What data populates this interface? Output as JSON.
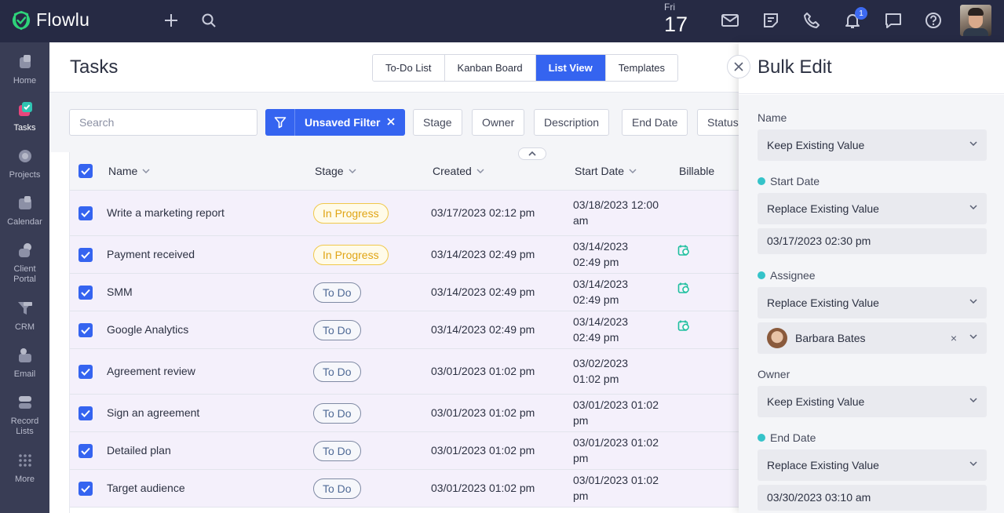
{
  "app": {
    "name": "Flowlu"
  },
  "topbar": {
    "day_of_week": "Fri",
    "day": "17",
    "notifications_count": "1"
  },
  "sidebar": {
    "items": [
      {
        "label": "Home",
        "icon": "home-icon"
      },
      {
        "label": "Tasks",
        "icon": "tasks-icon"
      },
      {
        "label": "Projects",
        "icon": "projects-icon"
      },
      {
        "label": "Calendar",
        "icon": "calendar-icon"
      },
      {
        "label": "Client\nPortal",
        "icon": "client-portal-icon"
      },
      {
        "label": "CRM",
        "icon": "crm-icon"
      },
      {
        "label": "Email",
        "icon": "email-icon"
      },
      {
        "label": "Record\nLists",
        "icon": "record-lists-icon"
      },
      {
        "label": "More",
        "icon": "more-icon"
      }
    ]
  },
  "header": {
    "title": "Tasks",
    "views": [
      "To-Do List",
      "Kanban Board",
      "List View",
      "Templates"
    ],
    "active_view": "List View"
  },
  "filters": {
    "search_placeholder": "Search",
    "filter_label": "Unsaved Filter",
    "chips": [
      "Stage",
      "Owner",
      "Description",
      "End Date",
      "Status"
    ]
  },
  "table": {
    "columns": [
      "Name",
      "Stage",
      "Created",
      "Start Date",
      "Billable"
    ],
    "rows": [
      {
        "name": "Write a marketing report",
        "stage": "In Progress",
        "created": "03/17/2023 02:12 pm",
        "start_line1": "03/18/2023 12:00",
        "start_line2": "am",
        "billable": false
      },
      {
        "name": "Payment received",
        "stage": "In Progress",
        "created": "03/14/2023 02:49 pm",
        "start_line1": "03/14/2023",
        "start_line2": "02:49 pm",
        "billable": true
      },
      {
        "name": "SMM",
        "stage": "To Do",
        "created": "03/14/2023 02:49 pm",
        "start_line1": "03/14/2023",
        "start_line2": "02:49 pm",
        "billable": true
      },
      {
        "name": "Google Analytics",
        "stage": "To Do",
        "created": "03/14/2023 02:49 pm",
        "start_line1": "03/14/2023",
        "start_line2": "02:49 pm",
        "billable": true
      },
      {
        "name": "Agreement review",
        "stage": "To Do",
        "created": "03/01/2023 01:02 pm",
        "start_line1": "03/02/2023",
        "start_line2": "01:02 pm",
        "billable": false
      },
      {
        "name": "Sign an agreement",
        "stage": "To Do",
        "created": "03/01/2023 01:02 pm",
        "start_line1": "03/01/2023 01:02",
        "start_line2": "pm",
        "billable": false
      },
      {
        "name": "Detailed plan",
        "stage": "To Do",
        "created": "03/01/2023 01:02 pm",
        "start_line1": "03/01/2023 01:02",
        "start_line2": "pm",
        "billable": false
      },
      {
        "name": "Target audience",
        "stage": "To Do",
        "created": "03/01/2023 01:02 pm",
        "start_line1": "03/01/2023 01:02",
        "start_line2": "pm",
        "billable": false
      }
    ]
  },
  "bulk_edit": {
    "title": "Bulk Edit",
    "name_label": "Name",
    "name_value": "Keep Existing Value",
    "start_date_label": "Start Date",
    "start_date_mode": "Replace Existing Value",
    "start_date_value": "03/17/2023 02:30 pm",
    "assignee_label": "Assignee",
    "assignee_mode": "Replace Existing Value",
    "assignee_value": "Barbara Bates",
    "owner_label": "Owner",
    "owner_value": "Keep Existing Value",
    "end_date_label": "End Date",
    "end_date_mode": "Replace Existing Value",
    "end_date_value": "03/30/2023 03:10 am"
  },
  "colors": {
    "accent": "#3564f0",
    "topbar": "#262a44",
    "sidebar": "#393d55",
    "in_progress": "#e0a414",
    "required_dot": "#35c3c9",
    "billable_icon": "#1fbf9f"
  }
}
